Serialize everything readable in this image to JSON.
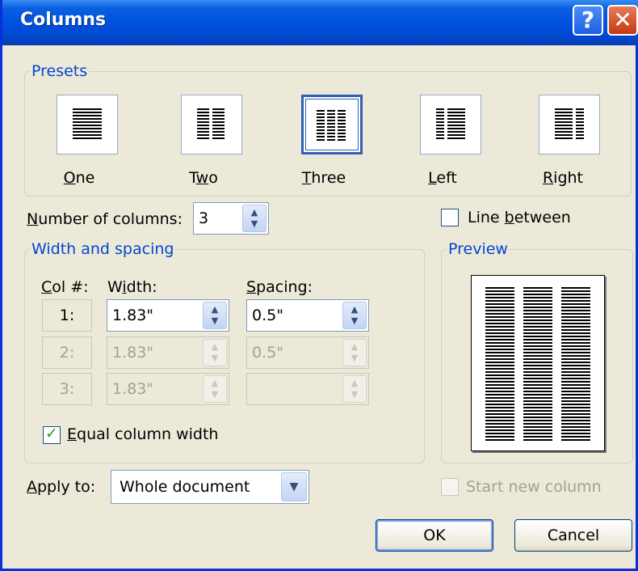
{
  "dialog": {
    "title": "Columns",
    "help_glyph": "?",
    "close_glyph": "✕"
  },
  "presets": {
    "legend": "Presets",
    "items": [
      {
        "label": "One",
        "mnemonic": "O",
        "rest": "ne"
      },
      {
        "label": "Two",
        "pre": "T",
        "mnemonic": "w",
        "rest": "o"
      },
      {
        "label": "Three",
        "mnemonic": "T",
        "rest": "hree",
        "selected": true
      },
      {
        "label": "Left",
        "mnemonic": "L",
        "rest": "eft"
      },
      {
        "label": "Right",
        "mnemonic": "R",
        "rest": "ight"
      }
    ]
  },
  "number_of_columns": {
    "label_mn": "N",
    "label_rest": "umber of columns:",
    "value": "3"
  },
  "line_between": {
    "label_pre": "Line ",
    "label_mn": "b",
    "label_rest": "etween",
    "checked": false
  },
  "width_spacing": {
    "legend": "Width and spacing",
    "col_header_mn": "C",
    "col_header_rest": "ol #:",
    "width_header_pre": "W",
    "width_header_mn": "i",
    "width_header_rest": "dth:",
    "spacing_header_mn": "S",
    "spacing_header_rest": "pacing:",
    "rows": [
      {
        "col": "1:",
        "width": "1.83\"",
        "spacing": "0.5\"",
        "enabled": true
      },
      {
        "col": "2:",
        "width": "1.83\"",
        "spacing": "0.5\"",
        "enabled": false
      },
      {
        "col": "3:",
        "width": "1.83\"",
        "spacing": "",
        "enabled": false
      }
    ],
    "equal_width_mn": "E",
    "equal_width_rest": "qual column width",
    "equal_width_checked": true
  },
  "preview": {
    "legend": "Preview"
  },
  "apply_to": {
    "label_mn": "A",
    "label_rest": "pply to:",
    "value": "Whole document"
  },
  "start_new_column": {
    "label": "Start new column",
    "checked": false,
    "enabled": false
  },
  "buttons": {
    "ok": "OK",
    "cancel": "Cancel"
  },
  "colors": {
    "title_bar": "#0054e3",
    "group_legend": "#0046d5",
    "dialog_bg": "#ece9d8"
  }
}
